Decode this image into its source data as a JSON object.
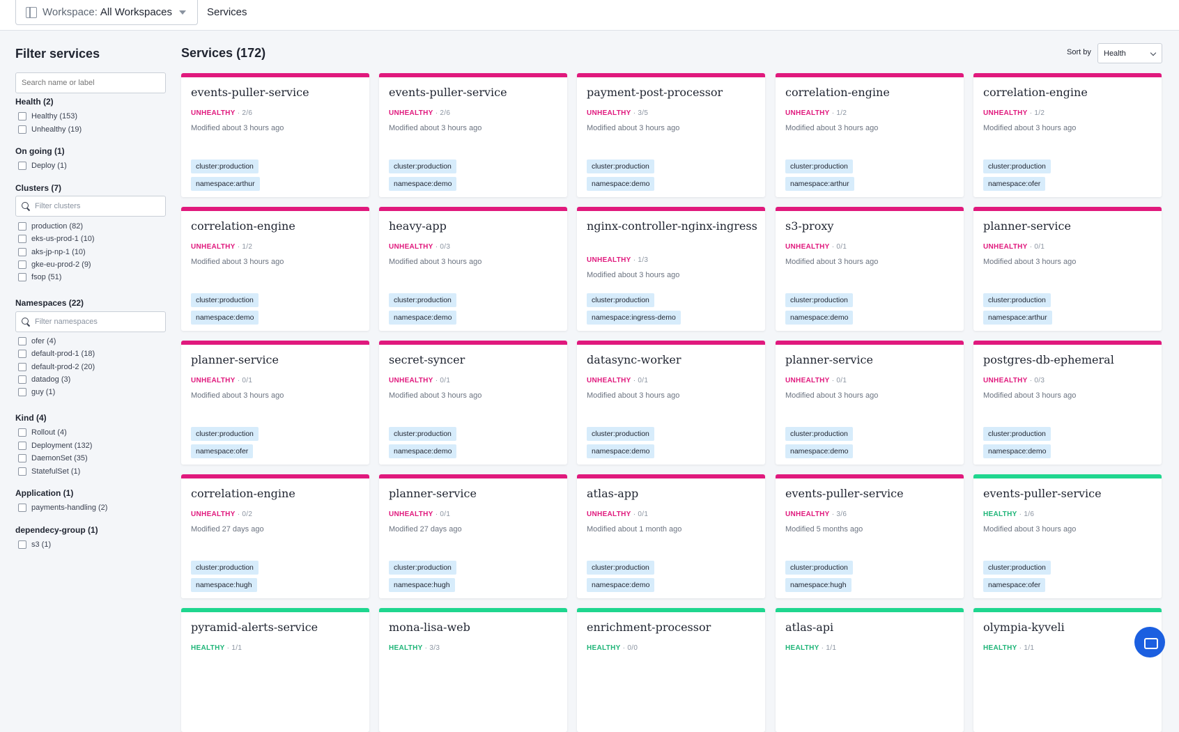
{
  "topbar": {
    "workspace_label": "Workspace:",
    "workspace_value": "All Workspaces",
    "page_title": "Services"
  },
  "sidebar": {
    "title": "Filter services",
    "search_placeholder": "Search name or label",
    "health": {
      "title": "Health (2)",
      "options": [
        "Healthy (153)",
        "Unhealthy (19)"
      ]
    },
    "ongoing": {
      "title": "On going (1)",
      "options": [
        "Deploy (1)"
      ]
    },
    "clusters": {
      "title": "Clusters (7)",
      "filter_placeholder": "Filter clusters",
      "options": [
        "production (82)",
        "eks-us-prod-1 (10)",
        "aks-jp-np-1 (10)",
        "gke-eu-prod-2 (9)",
        "fsop (51)"
      ]
    },
    "namespaces": {
      "title": "Namespaces (22)",
      "filter_placeholder": "Filter namespaces",
      "options": [
        "ofer (4)",
        "default-prod-1 (18)",
        "default-prod-2 (20)",
        "datadog (3)",
        "guy (1)"
      ]
    },
    "kind": {
      "title": "Kind (4)",
      "options": [
        "Rollout (4)",
        "Deployment (132)",
        "DaemonSet (35)",
        "StatefulSet (1)"
      ]
    },
    "application": {
      "title": "Application (1)",
      "options": [
        "payments-handling (2)"
      ]
    },
    "dependency": {
      "title": "dependecy-group (1)",
      "options": [
        "s3 (1)"
      ]
    }
  },
  "main": {
    "title": "Services (172)",
    "sort_label": "Sort by",
    "sort_value": "Health"
  },
  "services": [
    {
      "name": "events-puller-service",
      "status": "UNHEALTHY",
      "count": "2/6",
      "modified": "Modified about 3 hours ago",
      "cluster": "cluster:production",
      "namespace": "namespace:arthur"
    },
    {
      "name": "events-puller-service",
      "status": "UNHEALTHY",
      "count": "2/6",
      "modified": "Modified about 3 hours ago",
      "cluster": "cluster:production",
      "namespace": "namespace:demo"
    },
    {
      "name": "payment-post-processor",
      "status": "UNHEALTHY",
      "count": "3/5",
      "modified": "Modified about 3 hours ago",
      "cluster": "cluster:production",
      "namespace": "namespace:demo"
    },
    {
      "name": "correlation-engine",
      "status": "UNHEALTHY",
      "count": "1/2",
      "modified": "Modified about 3 hours ago",
      "cluster": "cluster:production",
      "namespace": "namespace:arthur"
    },
    {
      "name": "correlation-engine",
      "status": "UNHEALTHY",
      "count": "1/2",
      "modified": "Modified about 3 hours ago",
      "cluster": "cluster:production",
      "namespace": "namespace:ofer"
    },
    {
      "name": "correlation-engine",
      "status": "UNHEALTHY",
      "count": "1/2",
      "modified": "Modified about 3 hours ago",
      "cluster": "cluster:production",
      "namespace": "namespace:demo"
    },
    {
      "name": "heavy-app",
      "status": "UNHEALTHY",
      "count": "0/3",
      "modified": "Modified about 3 hours ago",
      "cluster": "cluster:production",
      "namespace": "namespace:demo"
    },
    {
      "name": "nginx-controller-nginx-ingress",
      "status": "UNHEALTHY",
      "count": "1/3",
      "modified": "Modified about 3 hours ago",
      "cluster": "cluster:production",
      "namespace": "namespace:ingress-demo"
    },
    {
      "name": "s3-proxy",
      "status": "UNHEALTHY",
      "count": "0/1",
      "modified": "Modified about 3 hours ago",
      "cluster": "cluster:production",
      "namespace": "namespace:demo"
    },
    {
      "name": "planner-service",
      "status": "UNHEALTHY",
      "count": "0/1",
      "modified": "Modified about 3 hours ago",
      "cluster": "cluster:production",
      "namespace": "namespace:arthur"
    },
    {
      "name": "planner-service",
      "status": "UNHEALTHY",
      "count": "0/1",
      "modified": "Modified about 3 hours ago",
      "cluster": "cluster:production",
      "namespace": "namespace:ofer"
    },
    {
      "name": "secret-syncer",
      "status": "UNHEALTHY",
      "count": "0/1",
      "modified": "Modified about 3 hours ago",
      "cluster": "cluster:production",
      "namespace": "namespace:demo"
    },
    {
      "name": "datasync-worker",
      "status": "UNHEALTHY",
      "count": "0/1",
      "modified": "Modified about 3 hours ago",
      "cluster": "cluster:production",
      "namespace": "namespace:demo"
    },
    {
      "name": "planner-service",
      "status": "UNHEALTHY",
      "count": "0/1",
      "modified": "Modified about 3 hours ago",
      "cluster": "cluster:production",
      "namespace": "namespace:demo"
    },
    {
      "name": "postgres-db-ephemeral",
      "status": "UNHEALTHY",
      "count": "0/3",
      "modified": "Modified about 3 hours ago",
      "cluster": "cluster:production",
      "namespace": "namespace:demo"
    },
    {
      "name": "correlation-engine",
      "status": "UNHEALTHY",
      "count": "0/2",
      "modified": "Modified 27 days ago",
      "cluster": "cluster:production",
      "namespace": "namespace:hugh"
    },
    {
      "name": "planner-service",
      "status": "UNHEALTHY",
      "count": "0/1",
      "modified": "Modified 27 days ago",
      "cluster": "cluster:production",
      "namespace": "namespace:hugh"
    },
    {
      "name": "atlas-app",
      "status": "UNHEALTHY",
      "count": "0/1",
      "modified": "Modified about 1 month ago",
      "cluster": "cluster:production",
      "namespace": "namespace:demo"
    },
    {
      "name": "events-puller-service",
      "status": "UNHEALTHY",
      "count": "3/6",
      "modified": "Modified 5 months ago",
      "cluster": "cluster:production",
      "namespace": "namespace:hugh"
    },
    {
      "name": "events-puller-service",
      "status": "HEALTHY",
      "count": "1/6",
      "modified": "Modified about 3 hours ago",
      "cluster": "cluster:production",
      "namespace": "namespace:ofer"
    },
    {
      "name": "pyramid-alerts-service",
      "status": "HEALTHY",
      "count": "1/1",
      "modified": "",
      "cluster": "",
      "namespace": ""
    },
    {
      "name": "mona-lisa-web",
      "status": "HEALTHY",
      "count": "3/3",
      "modified": "",
      "cluster": "",
      "namespace": ""
    },
    {
      "name": "enrichment-processor",
      "status": "HEALTHY",
      "count": "0/0",
      "modified": "",
      "cluster": "",
      "namespace": ""
    },
    {
      "name": "atlas-api",
      "status": "HEALTHY",
      "count": "1/1",
      "modified": "",
      "cluster": "",
      "namespace": ""
    },
    {
      "name": "olympia-kyveli",
      "status": "HEALTHY",
      "count": "1/1",
      "modified": "",
      "cluster": "",
      "namespace": ""
    }
  ],
  "colors": {
    "unhealthy": "#e0197d",
    "healthy": "#1fd68f",
    "tag_bg": "#d7ecfb"
  }
}
